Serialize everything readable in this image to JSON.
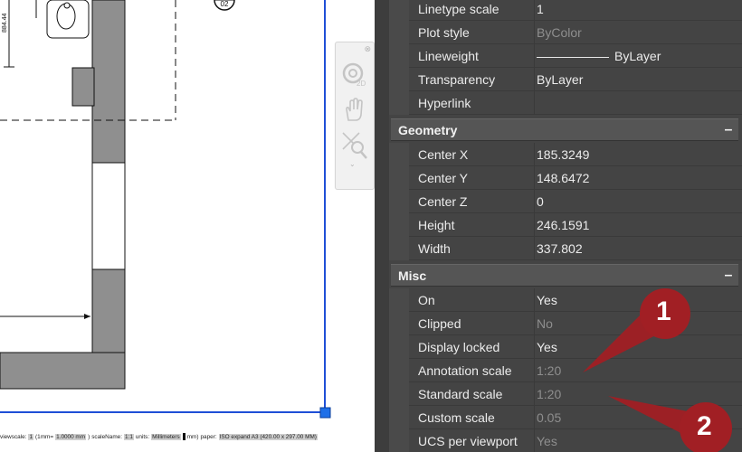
{
  "drawing": {
    "dimension_text": "884.44",
    "view_label": "02",
    "status": {
      "vs_label": "viewscale:",
      "vs_value": "1",
      "ratio_open": "(1mm=",
      "ratio_value": "1.0000 mm",
      "ratio_close": ")",
      "scalename_label": "scaleName:",
      "scalename_value": "1:1",
      "units_label": "units:",
      "units_value": "Millimeters",
      "units_tail": "mm)",
      "paper_label": "paper:",
      "paper_value": "ISO expand A3 (420.00 x 297.00 MM)"
    }
  },
  "navigation_bar": {
    "close_glyph": "⊗",
    "menu_glyph": "⌄",
    "tool_icons": [
      "steering-wheel-2d-icon",
      "pan-hand-icon",
      "zoom-extents-icon"
    ]
  },
  "properties": {
    "general_rows": [
      {
        "label": "Linetype scale",
        "value": "1",
        "muted": false
      },
      {
        "label": "Plot style",
        "value": "ByColor",
        "muted": true
      },
      {
        "label": "Lineweight",
        "value": "ByLayer",
        "muted": false,
        "line": true
      },
      {
        "label": "Transparency",
        "value": "ByLayer",
        "muted": false
      },
      {
        "label": "Hyperlink",
        "value": "",
        "muted": false
      }
    ],
    "geometry": {
      "title": "Geometry",
      "toggle": "–",
      "rows": [
        {
          "label": "Center X",
          "value": "185.3249",
          "muted": false
        },
        {
          "label": "Center Y",
          "value": "148.6472",
          "muted": false
        },
        {
          "label": "Center Z",
          "value": "0",
          "muted": false
        },
        {
          "label": "Height",
          "value": "246.1591",
          "muted": false
        },
        {
          "label": "Width",
          "value": "337.802",
          "muted": false
        }
      ]
    },
    "misc": {
      "title": "Misc",
      "toggle": "–",
      "rows": [
        {
          "label": "On",
          "value": "Yes",
          "muted": false
        },
        {
          "label": "Clipped",
          "value": "No",
          "muted": true
        },
        {
          "label": "Display locked",
          "value": "Yes",
          "muted": false
        },
        {
          "label": "Annotation scale",
          "value": "1:20",
          "muted": true
        },
        {
          "label": "Standard scale",
          "value": "1:20",
          "muted": true
        },
        {
          "label": "Custom scale",
          "value": "0.05",
          "muted": true
        },
        {
          "label": "UCS per viewport",
          "value": "Yes",
          "muted": true
        }
      ]
    }
  },
  "callouts": [
    {
      "number": "1"
    },
    {
      "number": "2"
    }
  ],
  "colors": {
    "panel_bg": "#444444",
    "section_bg": "#555555",
    "wall_fill": "#8f8f8f",
    "viewport_border": "#1f4fd6",
    "grip": "#1e6fe8",
    "callout": "#a11f24"
  }
}
